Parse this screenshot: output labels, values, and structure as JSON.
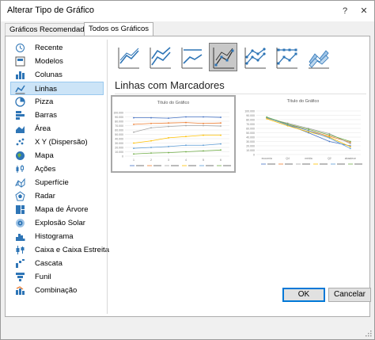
{
  "dialog": {
    "title": "Alterar Tipo de Gráfico",
    "help_label": "?",
    "close_label": "✕"
  },
  "tabs": [
    {
      "label": "Gráficos Recomendados"
    },
    {
      "label": "Todos os Gráficos"
    }
  ],
  "sidebar": {
    "items": [
      {
        "label": "Recente",
        "icon": "recent-icon"
      },
      {
        "label": "Modelos",
        "icon": "templates-icon"
      },
      {
        "label": "Colunas",
        "icon": "column-chart-icon"
      },
      {
        "label": "Linhas",
        "icon": "line-chart-icon",
        "selected": true
      },
      {
        "label": "Pizza",
        "icon": "pie-chart-icon"
      },
      {
        "label": "Barras",
        "icon": "bar-chart-icon"
      },
      {
        "label": "Área",
        "icon": "area-chart-icon"
      },
      {
        "label": "X Y (Dispersão)",
        "icon": "scatter-chart-icon"
      },
      {
        "label": "Mapa",
        "icon": "map-chart-icon"
      },
      {
        "label": "Ações",
        "icon": "stock-chart-icon"
      },
      {
        "label": "Superfície",
        "icon": "surface-chart-icon"
      },
      {
        "label": "Radar",
        "icon": "radar-chart-icon"
      },
      {
        "label": "Mapa de Árvore",
        "icon": "treemap-icon"
      },
      {
        "label": "Explosão Solar",
        "icon": "sunburst-icon"
      },
      {
        "label": "Histograma",
        "icon": "histogram-icon"
      },
      {
        "label": "Caixa e Caixa Estreita",
        "icon": "box-whisker-icon"
      },
      {
        "label": "Cascata",
        "icon": "waterfall-icon"
      },
      {
        "label": "Funil",
        "icon": "funnel-icon"
      },
      {
        "label": "Combinação",
        "icon": "combo-chart-icon"
      }
    ]
  },
  "main": {
    "subtype_title": "Linhas com Marcadores",
    "previews": [
      {
        "title": "Título do Gráfico",
        "y_ticks": [
          "100.000",
          "90.000",
          "80.000",
          "70.000",
          "60.000",
          "50.000",
          "40.000",
          "30.000",
          "20.000",
          "10.000",
          "0"
        ],
        "x_ticks": [
          "1",
          "2",
          "3",
          "4",
          "5",
          "6"
        ]
      },
      {
        "title": "Título do Gráfico",
        "y_ticks": [
          "100.000",
          "90.000",
          "80.000",
          "70.000",
          "60.000",
          "50.000",
          "40.000",
          "30.000",
          "20.000",
          "10.000",
          "0"
        ],
        "x_ticks": [
          "ecoomia",
          "Q4",
          "média",
          "Q2",
          "abastece"
        ]
      }
    ]
  },
  "footer": {
    "ok_label": "OK",
    "cancel_label": "Cancelar"
  },
  "colors": {
    "accent": "#0078d7",
    "selected_bg": "#cce4f7",
    "series": [
      "#4472c4",
      "#ed7d31",
      "#a5a5a5",
      "#ffc000",
      "#5b9bd5",
      "#70ad47"
    ]
  }
}
